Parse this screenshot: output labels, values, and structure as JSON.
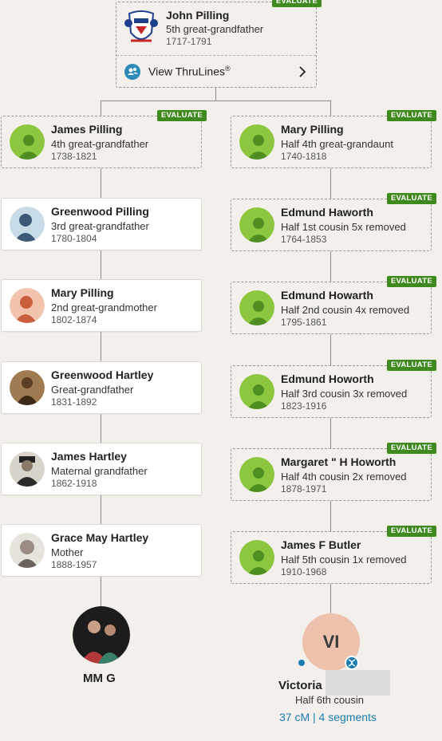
{
  "top": {
    "badge": "EVALUATE",
    "name": "John Pilling",
    "relationship": "5th great-grandfather",
    "years": "1717-1791",
    "icon": "coat-of-arms",
    "thrulines_label": "View ThruLines",
    "thrulines_reg": "®"
  },
  "left": [
    {
      "name": "James Pilling",
      "relationship": "4th great-grandfather",
      "years": "1738-1821",
      "badge": "EVALUATE"
    },
    {
      "name": "Greenwood Pilling",
      "relationship": "3rd great-grandfather",
      "years": "1780-1804"
    },
    {
      "name": "Mary Pilling",
      "relationship": "2nd great-grandmother",
      "years": "1802-1874"
    },
    {
      "name": "Greenwood Hartley",
      "relationship": "Great-grandfather",
      "years": "1831-1892"
    },
    {
      "name": "James Hartley",
      "relationship": "Maternal grandfather",
      "years": "1862-1918"
    },
    {
      "name": "Grace May Hartley",
      "relationship": "Mother",
      "years": "1888-1957"
    }
  ],
  "right": [
    {
      "name": "Mary Pilling",
      "relationship": "Half 4th great-grandaunt",
      "years": "1740-1818",
      "badge": "EVALUATE"
    },
    {
      "name": "Edmund Haworth",
      "relationship": "Half 1st cousin 5x removed",
      "years": "1764-1853",
      "badge": "EVALUATE"
    },
    {
      "name": "Edmund Howarth",
      "relationship": "Half 2nd cousin 4x removed",
      "years": "1795-1861",
      "badge": "EVALUATE"
    },
    {
      "name": "Edmund Howorth",
      "relationship": "Half 3rd cousin 3x removed",
      "years": "1823-1916",
      "badge": "EVALUATE"
    },
    {
      "name": "Margaret \" H Howorth",
      "relationship": "Half 4th cousin 2x removed",
      "years": "1878-1971",
      "badge": "EVALUATE"
    },
    {
      "name": "James F Butler",
      "relationship": "Half 5th cousin 1x removed",
      "years": "1910-1968",
      "badge": "EVALUATE"
    }
  ],
  "self": {
    "name": "MM G"
  },
  "match": {
    "initials": "VI",
    "name": "Victoria",
    "relationship": "Half 6th cousin",
    "dna_cm": "37 cM",
    "dna_sep": " | ",
    "dna_segments": "4 segments"
  },
  "colors": {
    "evaluate_badge": "#3f8a1e",
    "link": "#1a7db0",
    "leaf_green": "#8dc63f",
    "match_avatar": "#edc1ab"
  }
}
